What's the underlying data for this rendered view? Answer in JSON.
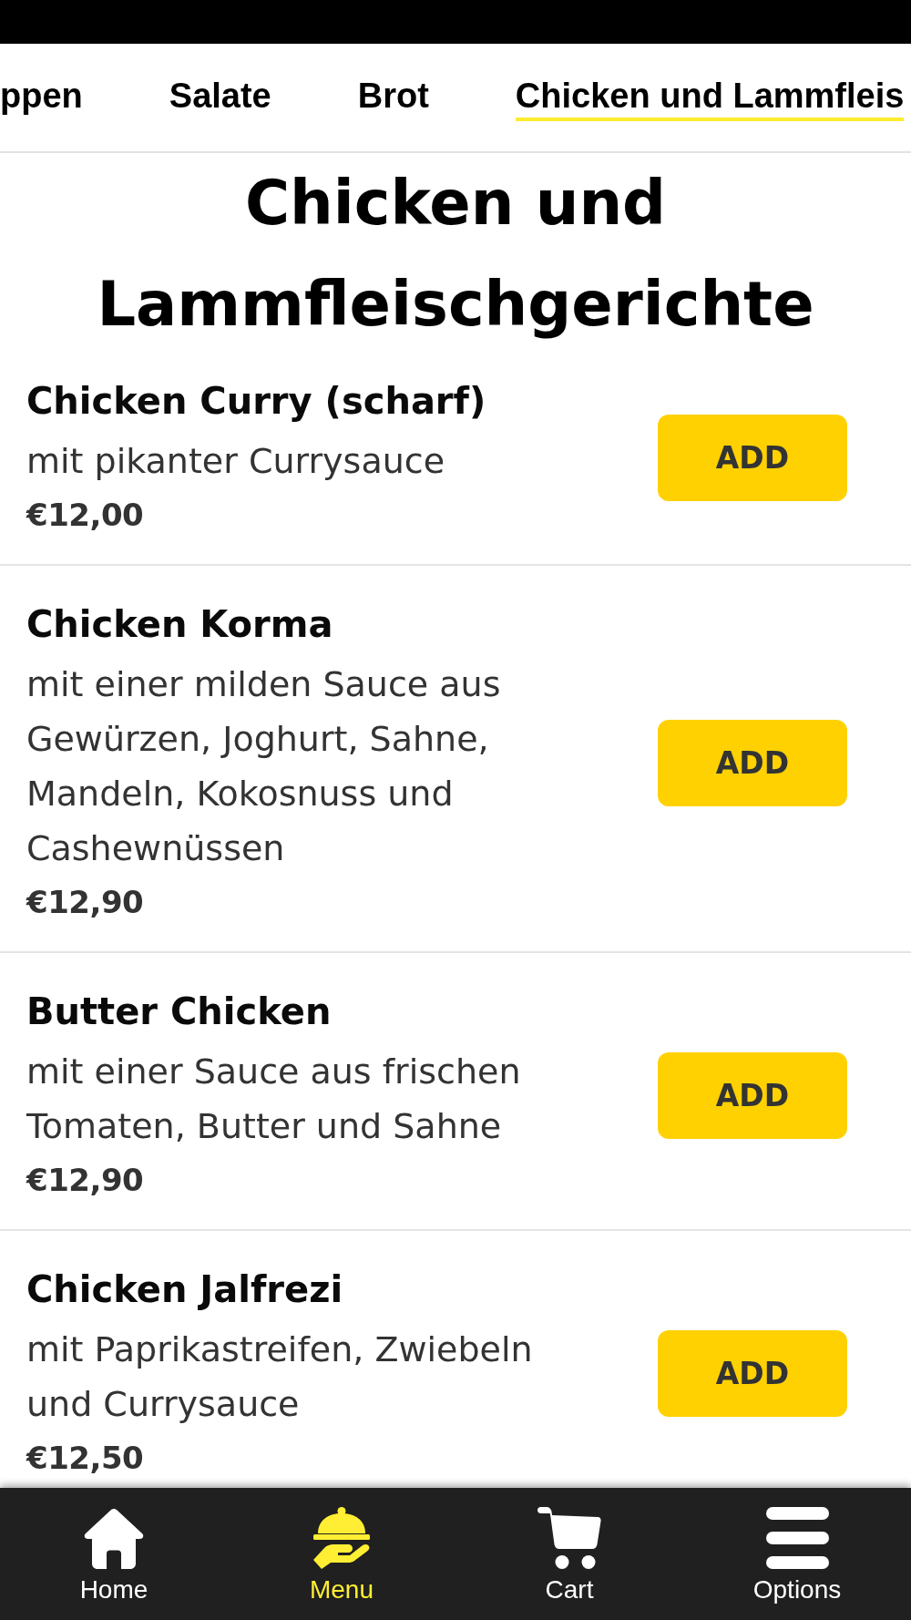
{
  "category_tabs": [
    {
      "label": "ppen",
      "selected": false
    },
    {
      "label": "Salate",
      "selected": false
    },
    {
      "label": "Brot",
      "selected": false
    },
    {
      "label": "Chicken und Lammfleis",
      "selected": true
    }
  ],
  "section_title": "Chicken und Lammfleischgerichte",
  "items": [
    {
      "name": "Chicken Curry (scharf)",
      "description": "mit pikanter Currysauce",
      "price": "€12,00",
      "button": "ADD"
    },
    {
      "name": "Chicken Korma",
      "description": "mit einer milden Sauce aus Gewürzen, Joghurt, Sahne, Mandeln, Kokosnuss und Cashewnüssen",
      "price": "€12,90",
      "button": "ADD"
    },
    {
      "name": "Butter Chicken",
      "description": "mit einer Sauce aus frischen Tomaten, Butter und Sahne",
      "price": "€12,90",
      "button": "ADD"
    },
    {
      "name": "Chicken Jalfrezi",
      "description": "mit Paprikastreifen, Zwiebeln und Currysauce",
      "price": "€12,50",
      "button": "ADD"
    }
  ],
  "bottom_nav": [
    {
      "kind": "home",
      "label": "Home",
      "selected": false
    },
    {
      "kind": "dishes",
      "label": "Menu",
      "selected": true
    },
    {
      "kind": "cart",
      "label": "Cart",
      "selected": false
    },
    {
      "kind": "options",
      "label": "Options",
      "selected": false
    }
  ]
}
